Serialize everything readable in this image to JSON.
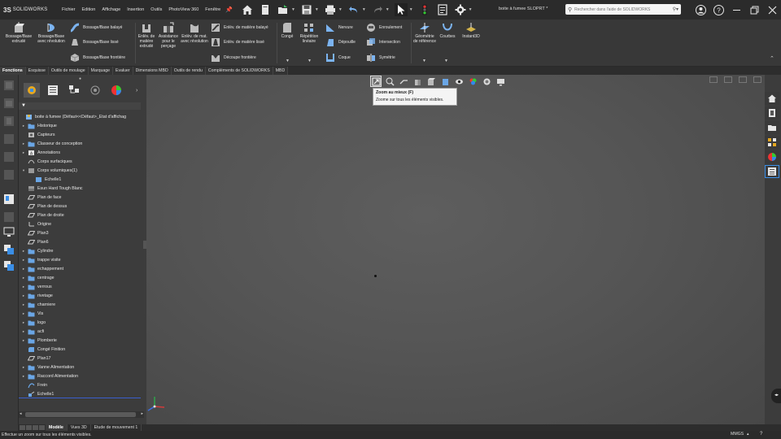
{
  "app": {
    "logo_ds": "3S",
    "logo_text": "SOLIDWORKS",
    "doc_title": "boite à fumee SLOPRT *"
  },
  "menus": [
    "Fichier",
    "Edition",
    "Affichage",
    "Insertion",
    "Outils",
    "PhotoView 360",
    "Fenêtre"
  ],
  "search": {
    "placeholder": "Rechercher dans l'aide de SOLIDWORKS"
  },
  "ribbon": {
    "boss_extrude": "Bossage/Base extrudé",
    "boss_revolve": "Bossage/Base avec révolution",
    "boss_sweep": "Bossage/Base balayé",
    "boss_loft": "Bossage/Base lissé",
    "boss_boundary": "Bossage/Base frontière",
    "cut_extrude": "Enlèv. de matière extrudé",
    "hole_wizard": "Assistance pour le perçage",
    "cut_revolve": "Enlèv. de mat. avec révolution",
    "cut_sweep": "Enlèv. de matière balayé",
    "cut_loft": "Enlèv. de matière lissé",
    "cut_boundary": "Découpe frontière",
    "fillet": "Congé",
    "linear_pattern": "Répétition linéaire",
    "rib": "Nervure",
    "draft": "Dépouille",
    "shell": "Coque",
    "wrap": "Enroulement",
    "intersect": "Intersection",
    "mirror": "Symétrie",
    "ref_geometry": "Géométrie de référence",
    "curves": "Courbes",
    "instant3d": "Instant3D"
  },
  "cm_tabs": [
    "Fonctions",
    "Esquisse",
    "Outils de moulage",
    "Marquage",
    "Evaluer",
    "Dimensions MBD",
    "Outils de rendu",
    "Compléments de SOLIDWORKS",
    "MBD"
  ],
  "tree": [
    {
      "label": "boite à fumee  (Défaut<<Défaut>_Etat d'affichag",
      "level": 0,
      "expand": "",
      "icon": "part-icon"
    },
    {
      "label": "Historique",
      "level": 1,
      "expand": "▸",
      "icon": "folder-icon"
    },
    {
      "label": "Capteurs",
      "level": 1,
      "expand": "",
      "icon": "sensor-icon"
    },
    {
      "label": "Classeur de conception",
      "level": 1,
      "expand": "▸",
      "icon": "folder-icon"
    },
    {
      "label": "Annotations",
      "level": 1,
      "expand": "▸",
      "icon": "annotation-icon"
    },
    {
      "label": "Corps surfaciques",
      "level": 1,
      "expand": "",
      "icon": "surface-icon"
    },
    {
      "label": "Corps volumiques(1)",
      "level": 1,
      "expand": "▾",
      "icon": "solid-icon"
    },
    {
      "label": "Echelle1",
      "level": 2,
      "expand": "",
      "icon": "feature-icon"
    },
    {
      "label": "Esun Hard Tough Blanc",
      "level": 1,
      "expand": "",
      "icon": "material-icon"
    },
    {
      "label": "Plan de face",
      "level": 1,
      "expand": "",
      "icon": "plane-icon"
    },
    {
      "label": "Plan de dessus",
      "level": 1,
      "expand": "",
      "icon": "plane-icon"
    },
    {
      "label": "Plan de droite",
      "level": 1,
      "expand": "",
      "icon": "plane-icon"
    },
    {
      "label": "Origine",
      "level": 1,
      "expand": "",
      "icon": "origin-icon"
    },
    {
      "label": "Plan3",
      "level": 1,
      "expand": "",
      "icon": "plane-icon"
    },
    {
      "label": "Plan6",
      "level": 1,
      "expand": "",
      "icon": "plane-icon"
    },
    {
      "label": "Cylindre",
      "level": 1,
      "expand": "▸",
      "icon": "folder-icon"
    },
    {
      "label": "trappe visite",
      "level": 1,
      "expand": "▸",
      "icon": "folder-icon"
    },
    {
      "label": "echappement",
      "level": 1,
      "expand": "▸",
      "icon": "folder-icon"
    },
    {
      "label": "centrage",
      "level": 1,
      "expand": "▸",
      "icon": "folder-icon"
    },
    {
      "label": "verrous",
      "level": 1,
      "expand": "▸",
      "icon": "folder-icon"
    },
    {
      "label": "rivetage",
      "level": 1,
      "expand": "▸",
      "icon": "folder-icon"
    },
    {
      "label": "charniere",
      "level": 1,
      "expand": "▸",
      "icon": "folder-icon"
    },
    {
      "label": "Vis",
      "level": 1,
      "expand": "▸",
      "icon": "folder-icon"
    },
    {
      "label": "logo",
      "level": 1,
      "expand": "▸",
      "icon": "folder-icon"
    },
    {
      "label": "acfi",
      "level": 1,
      "expand": "▸",
      "icon": "folder-icon"
    },
    {
      "label": "Plomberie",
      "level": 1,
      "expand": "▸",
      "icon": "folder-icon"
    },
    {
      "label": "Congé Finition",
      "level": 1,
      "expand": "",
      "icon": "fillet-icon"
    },
    {
      "label": "Plan17",
      "level": 1,
      "expand": "",
      "icon": "plane-icon"
    },
    {
      "label": "Vanne Alimentation",
      "level": 1,
      "expand": "▸",
      "icon": "folder-icon"
    },
    {
      "label": "Raccord Alimentation",
      "level": 1,
      "expand": "▸",
      "icon": "folder-icon"
    },
    {
      "label": "Frein",
      "level": 1,
      "expand": "",
      "icon": "sketch-icon"
    },
    {
      "label": "Echelle1",
      "level": 1,
      "expand": "",
      "icon": "scale-icon"
    }
  ],
  "tooltip": {
    "title": "Zoom au mieux   (F)",
    "body": "Zoome sur tous les éléments visibles."
  },
  "bottom_tabs": [
    "Modèle",
    "Vues 3D",
    "Etude de mouvement 1"
  ],
  "status": {
    "text": "Effectue un zoom sur tous les éléments visibles.",
    "units": "MMGS",
    "caret": "▴",
    "help": "?"
  },
  "colors": {
    "accent_blue": "#3a8ee6",
    "tree_separator": "#3a5fcd",
    "tooltip_bg": "#f4f4f4"
  }
}
